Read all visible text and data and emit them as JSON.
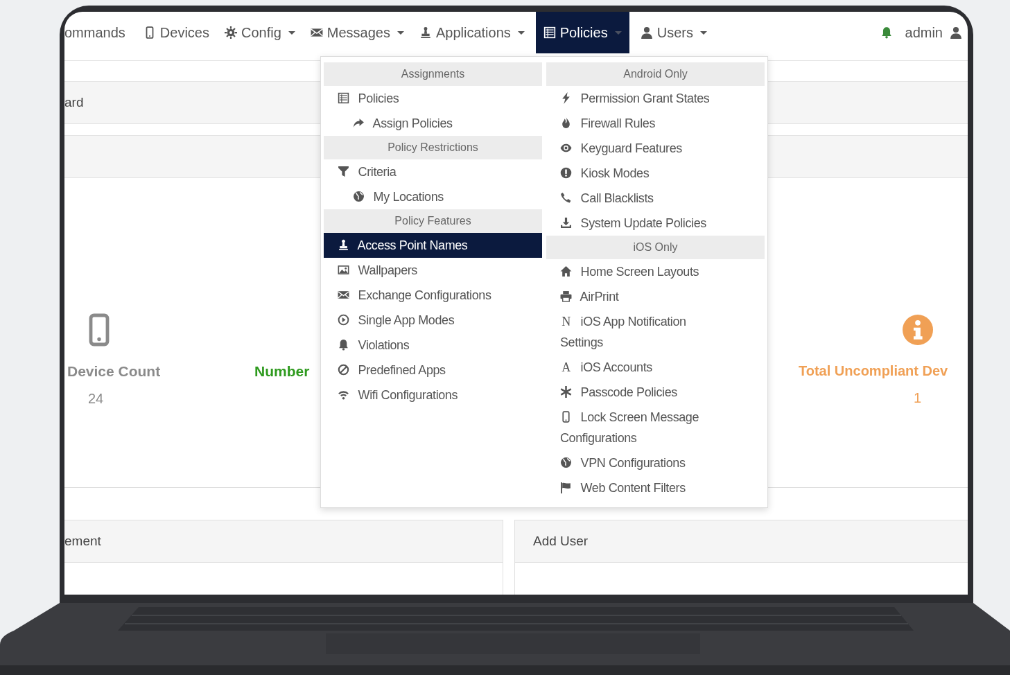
{
  "navbar": {
    "items": [
      {
        "label": "ommands",
        "dropdown": false,
        "selected": false
      },
      {
        "label": "Devices",
        "dropdown": false,
        "selected": false
      },
      {
        "label": "Config",
        "dropdown": true,
        "selected": false
      },
      {
        "label": "Messages",
        "dropdown": true,
        "selected": false
      },
      {
        "label": "Applications",
        "dropdown": true,
        "selected": false
      },
      {
        "label": "Policies",
        "dropdown": true,
        "selected": true
      },
      {
        "label": "Users",
        "dropdown": true,
        "selected": false
      }
    ],
    "user": "admin"
  },
  "breadcrumb": "ard",
  "stats": [
    {
      "label": "Device Count",
      "value": "24",
      "color": "#8a8a8a"
    },
    {
      "label": "Number",
      "color": "#2e9a1e"
    },
    {
      "label": "Total Uncompliant Dev",
      "value": "1",
      "color": "#f0a055"
    }
  ],
  "panels": [
    {
      "title": "ement"
    },
    {
      "title": "Add User"
    }
  ],
  "policies_menu": {
    "columns": [
      {
        "sections": [
          {
            "heading": "Assignments",
            "items": [
              {
                "label": "Policies",
                "selected": false,
                "children": [
                  {
                    "label": "Assign Policies",
                    "selected": false
                  }
                ]
              }
            ]
          },
          {
            "heading": "Policy Restrictions",
            "items": [
              {
                "label": "Criteria",
                "selected": false,
                "children": [
                  {
                    "label": "My Locations",
                    "selected": false
                  }
                ]
              }
            ]
          },
          {
            "heading": "Policy Features",
            "items": [
              {
                "label": "Access Point Names",
                "selected": true
              },
              {
                "label": "Wallpapers",
                "selected": false
              },
              {
                "label": "Exchange Configurations",
                "selected": false
              },
              {
                "label": "Single App Modes",
                "selected": false
              },
              {
                "label": "Violations",
                "selected": false
              },
              {
                "label": "Predefined Apps",
                "selected": false
              },
              {
                "label": "Wifi Configurations",
                "selected": false
              }
            ]
          }
        ]
      },
      {
        "sections": [
          {
            "heading": "Android Only",
            "items": [
              {
                "label": "Permission Grant States",
                "selected": false
              },
              {
                "label": "Firewall Rules",
                "selected": false
              },
              {
                "label": "Keyguard Features",
                "selected": false
              },
              {
                "label": "Kiosk Modes",
                "selected": false
              },
              {
                "label": "Call Blacklists",
                "selected": false
              },
              {
                "label": "System Update Policies",
                "selected": false
              }
            ]
          },
          {
            "heading": "iOS Only",
            "items": [
              {
                "label": "Home Screen Layouts",
                "selected": false
              },
              {
                "label": "AirPrint",
                "selected": false
              },
              {
                "label": "iOS App Notification Settings",
                "selected": false,
                "glyph": "N"
              },
              {
                "label": "iOS Accounts",
                "selected": false,
                "glyph": "A"
              },
              {
                "label": "Passcode Policies",
                "selected": false
              },
              {
                "label": "Lock Screen Message Configurations",
                "selected": false
              },
              {
                "label": "VPN Configurations",
                "selected": false
              },
              {
                "label": "Web Content Filters",
                "selected": false
              }
            ]
          }
        ]
      }
    ]
  }
}
